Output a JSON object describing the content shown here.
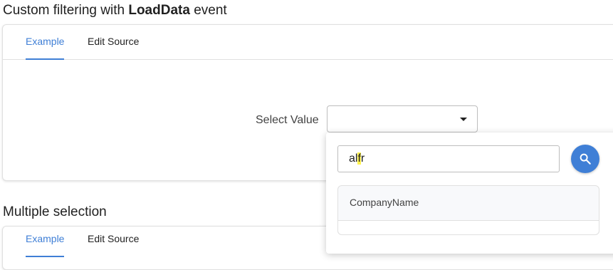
{
  "sections": [
    {
      "title_prefix": "Custom filtering with ",
      "title_bold": "LoadData",
      "title_suffix": " event",
      "tabs": [
        {
          "label": "Example",
          "active": true
        },
        {
          "label": "Edit Source",
          "active": false
        }
      ],
      "select_label": "Select Value",
      "select_value": ""
    },
    {
      "title": "Multiple selection",
      "tabs": [
        {
          "label": "Example",
          "active": true
        },
        {
          "label": "Edit Source",
          "active": false
        }
      ]
    }
  ],
  "popup": {
    "search_value_highlighted": "f",
    "search_value_prefix": "al",
    "search_value_suffix": "r",
    "search_button_icon": "search-icon",
    "grid": {
      "columns": [
        "CompanyName"
      ],
      "rows": []
    }
  },
  "colors": {
    "accent": "#3f7fd6",
    "highlight": "#fff34d",
    "border": "#e0e0e0"
  }
}
